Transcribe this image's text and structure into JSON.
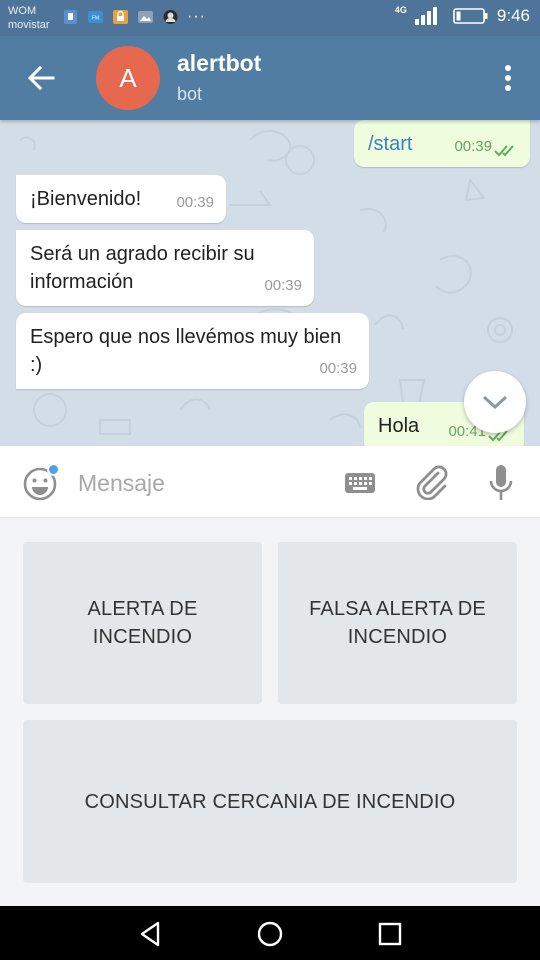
{
  "status_bar": {
    "carrier_line1": "WOM",
    "carrier_line2": "movistar",
    "overflow": "···",
    "network": "4G",
    "time": "9:46",
    "icons": [
      "sim-icon",
      "fm-icon",
      "lock-app-icon",
      "gallery-icon",
      "avatar-notif-icon",
      "signal-icon",
      "battery-icon"
    ]
  },
  "header": {
    "avatar_letter": "A",
    "title": "alertbot",
    "subtitle": "bot",
    "avatar_color": "#e5684f"
  },
  "messages": [
    {
      "direction": "out",
      "text": "/start",
      "time": "00:39",
      "read": true
    },
    {
      "direction": "in",
      "text": "¡Bienvenido!",
      "time": "00:39"
    },
    {
      "direction": "in",
      "text": "Será un agrado recibir su información",
      "time": "00:39"
    },
    {
      "direction": "in",
      "text": "Espero que nos llevémos muy bien :)",
      "time": "00:39"
    },
    {
      "direction": "out",
      "text": "Hola",
      "time": "00:41",
      "read": true
    }
  ],
  "input": {
    "placeholder": "Mensaje"
  },
  "keyboard": {
    "buttons": [
      {
        "label": "ALERTA DE\nINCENDIO"
      },
      {
        "label": "FALSA ALERTA DE\nINCENDIO"
      },
      {
        "label": "CONSULTAR CERCANIA DE INCENDIO"
      }
    ]
  },
  "colors": {
    "header": "#517da2",
    "status_bar": "#4f7499",
    "chat_background": "#d3dde7",
    "outgoing_bubble": "#effdde",
    "incoming_bubble": "#ffffff"
  }
}
